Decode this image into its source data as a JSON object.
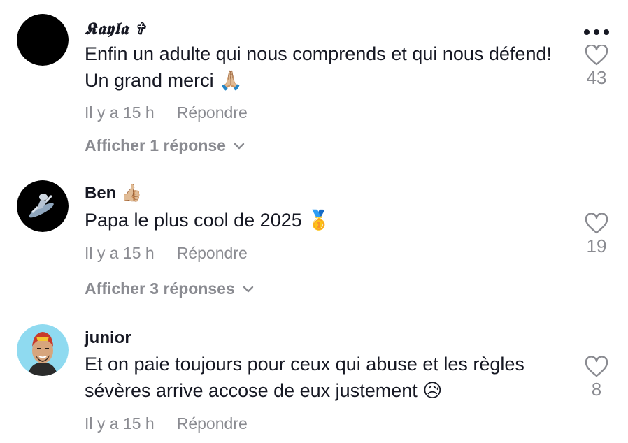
{
  "comments": [
    {
      "username": "𝕶𝖆𝖞𝖑𝖆 ✞",
      "text": "Enfin un adulte qui nous comprends et qui nous défend! Un grand merci 🙏🏼",
      "time": "Il y a 15 h",
      "reply_label": "Répondre",
      "replies_label": "Afficher 1 réponse",
      "likes": "43"
    },
    {
      "username": "Ben 👍🏼",
      "text": "Papa le plus cool de 2025 🥇",
      "time": "Il y a 15 h",
      "reply_label": "Répondre",
      "replies_label": "Afficher 3 réponses",
      "likes": "19"
    },
    {
      "username": "junior",
      "text": "Et on paie toujours pour ceux qui abuse et les règles sévères arrive accose de eux justement 😥",
      "time": "Il y a 15 h",
      "reply_label": "Répondre",
      "likes": "8"
    }
  ],
  "icons": {
    "more": "more-options-icon",
    "like": "heart-icon",
    "expand": "chevron-down-icon"
  },
  "colors": {
    "text": "#161823",
    "muted": "#8a8b91"
  }
}
